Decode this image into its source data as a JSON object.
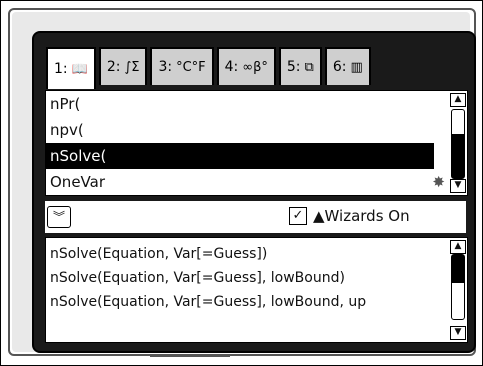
{
  "tabs": [
    {
      "num": "1:",
      "icon": "book-icon",
      "glyph": "📖"
    },
    {
      "num": "2:",
      "icon": "integral-sigma-icon",
      "glyph": "∫Σ"
    },
    {
      "num": "3:",
      "icon": "unit-conversion-icon",
      "glyph": "°C°F"
    },
    {
      "num": "4:",
      "icon": "symbols-icon",
      "glyph": "∞β°"
    },
    {
      "num": "5:",
      "icon": "templates-icon",
      "glyph": "⧉"
    },
    {
      "num": "6:",
      "icon": "library-icon",
      "glyph": "▥"
    }
  ],
  "list": {
    "items": [
      "nPr(",
      "npv(",
      "nSolve(",
      "OneVar"
    ],
    "selected_index": 2
  },
  "wizards": {
    "checked": true,
    "label": "▲Wizards On"
  },
  "help": {
    "lines": [
      "nSolve(Equation, Var[=Guess])",
      "nSolve(Equation, Var[=Guess], lowBound)",
      "nSolve(Equation, Var[=Guess], lowBound, up"
    ]
  }
}
